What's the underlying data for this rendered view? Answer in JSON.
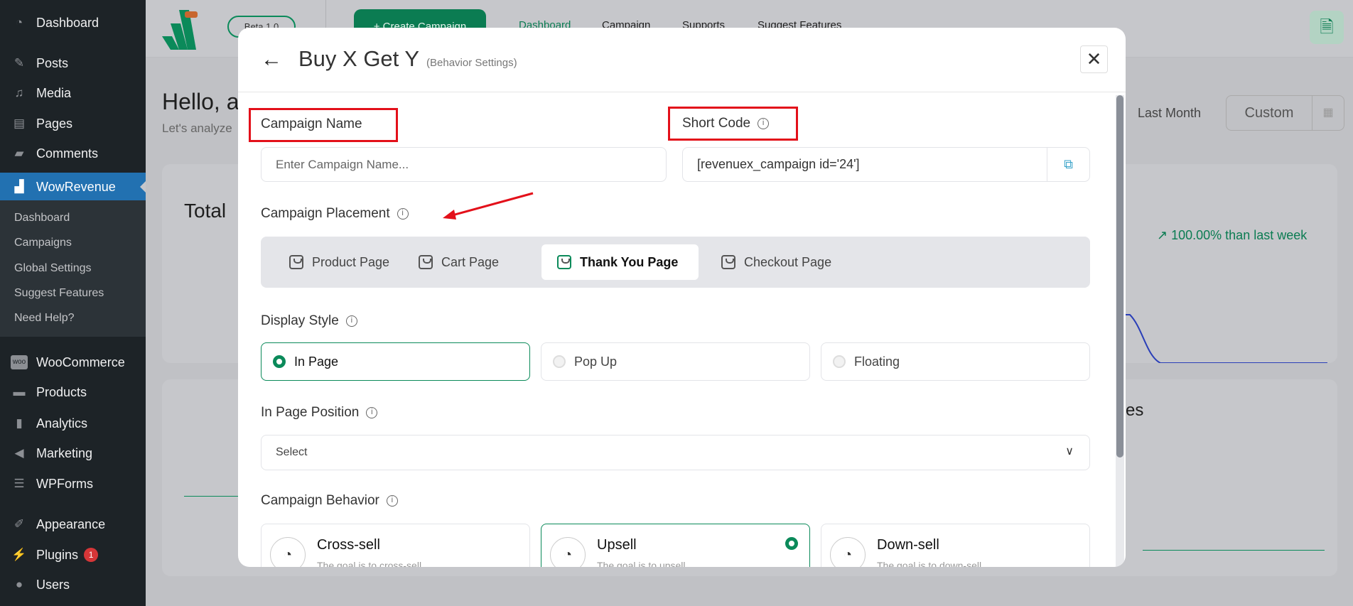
{
  "sidebar": {
    "items": [
      {
        "label": "Dashboard",
        "icon": "dashboard-icon"
      },
      {
        "label": "Posts",
        "icon": "pin-icon"
      },
      {
        "label": "Media",
        "icon": "media-icon"
      },
      {
        "label": "Pages",
        "icon": "pages-icon"
      },
      {
        "label": "Comments",
        "icon": "comment-icon"
      },
      {
        "label": "WowRevenue",
        "icon": "wowrevenue-icon"
      },
      {
        "label": "WooCommerce",
        "icon": "woo-icon"
      },
      {
        "label": "Products",
        "icon": "box-icon"
      },
      {
        "label": "Analytics",
        "icon": "bar-chart-icon"
      },
      {
        "label": "Marketing",
        "icon": "megaphone-icon"
      },
      {
        "label": "WPForms",
        "icon": "form-icon"
      },
      {
        "label": "Appearance",
        "icon": "brush-icon"
      },
      {
        "label": "Plugins",
        "icon": "plug-icon",
        "badge": "1"
      },
      {
        "label": "Users",
        "icon": "user-icon"
      }
    ],
    "submenu": [
      "Dashboard",
      "Campaigns",
      "Global Settings",
      "Suggest Features",
      "Need Help?"
    ]
  },
  "topbar": {
    "beta": "Beta 1.0",
    "logo_badge": "BETA",
    "create": "+ Create Campaign",
    "nav": [
      "Dashboard",
      "Campaign",
      "Supports",
      "Suggest Features"
    ]
  },
  "page": {
    "greeting": "Hello, a",
    "subtitle": "Let's analyze",
    "last_month": "Last Month",
    "custom": "Custom",
    "total": "Total",
    "trend": "100.00% than last week",
    "card2_title": "es"
  },
  "modal": {
    "title": "Buy X Get Y",
    "subtitle": "(Behavior Settings)",
    "campaign_name_label": "Campaign Name",
    "campaign_name_placeholder": "Enter Campaign Name...",
    "short_code_label": "Short Code",
    "short_code_value": "[revenuex_campaign id='24']",
    "placement_label": "Campaign Placement",
    "placement_tabs": [
      "Product Page",
      "Cart Page",
      "Thank You Page",
      "Checkout Page"
    ],
    "placement_active": "Thank You Page",
    "display_label": "Display Style",
    "display_options": [
      "In Page",
      "Pop Up",
      "Floating"
    ],
    "display_selected": "In Page",
    "position_label": "In Page Position",
    "position_value": "Select",
    "behavior_label": "Campaign Behavior",
    "behaviors": [
      {
        "title": "Cross-sell",
        "desc": "The goal is to cross-sell"
      },
      {
        "title": "Upsell",
        "desc": "The goal is to upsell"
      },
      {
        "title": "Down-sell",
        "desc": "The goal is to down-sell"
      }
    ],
    "behavior_selected": "Upsell"
  },
  "colors": {
    "accent": "#0b8a5a",
    "highlight": "#e3101a",
    "wp_blue": "#2271b1"
  }
}
